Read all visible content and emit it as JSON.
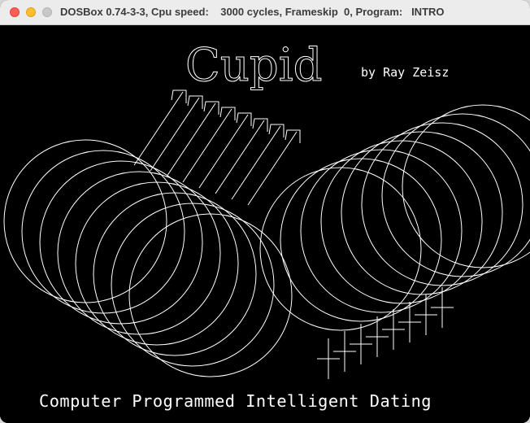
{
  "window": {
    "title": "DOSBox 0.74-3-3, Cpu speed:    3000 cycles, Frameskip  0, Program:   INTRO"
  },
  "game": {
    "title": "Cupid",
    "byline": "by Ray Zeisz",
    "tagline": "Computer Programmed Intelligent Dating"
  },
  "colors": {
    "screen_bg": "#000000",
    "line": "#ffffff"
  }
}
